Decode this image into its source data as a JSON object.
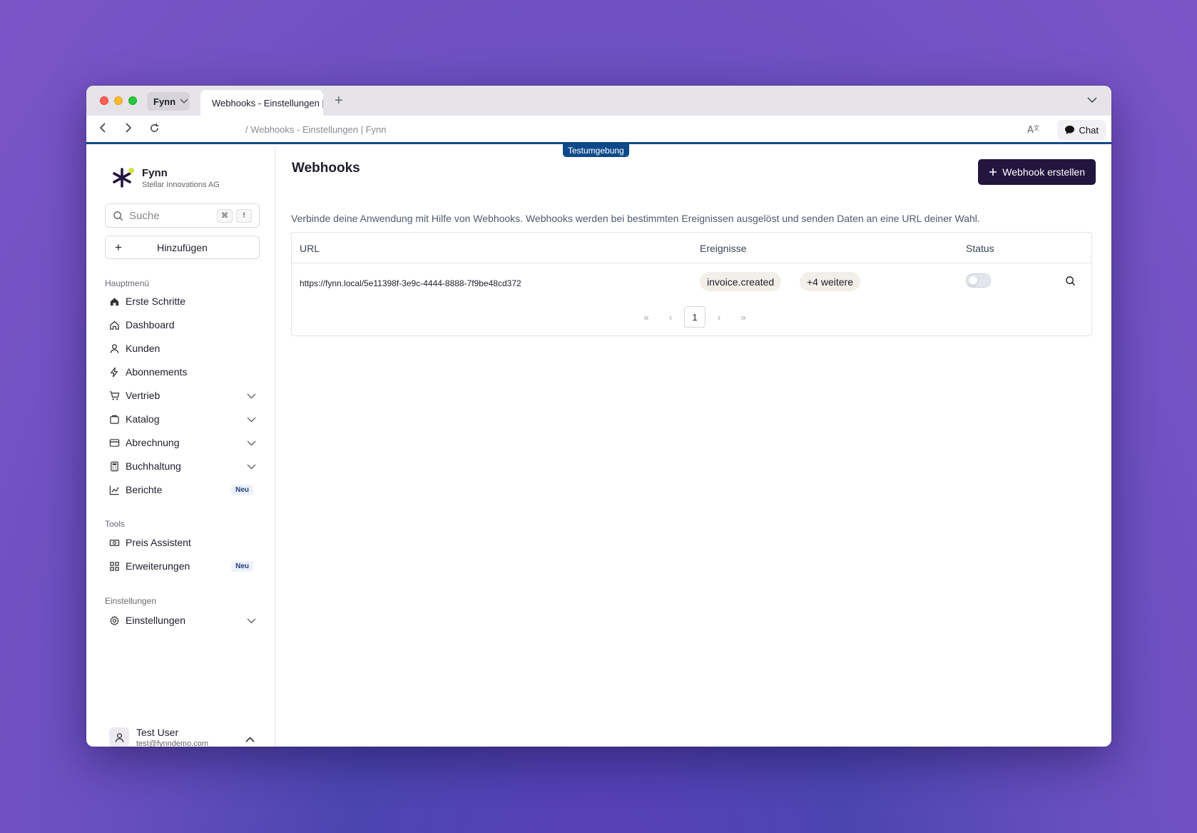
{
  "browser": {
    "profile_label": "Fynn",
    "tab_title": "Webhooks - Einstellungen | Fynn",
    "new_tab": "+",
    "address": "/ Webhooks - Einstellungen | Fynn",
    "chat_label": "Chat"
  },
  "environment_badge": "Testumgebung",
  "sidebar": {
    "brand_name": "Fynn",
    "brand_org": "Stellar Innovations AG",
    "search_placeholder": "Suche",
    "search_kbd_1": "⌘",
    "search_kbd_2": "f",
    "add_label": "Hinzufügen",
    "sections": {
      "main": "Hauptmenü",
      "tools": "Tools",
      "settings": "Einstellungen"
    },
    "main_items": [
      {
        "label": "Erste Schritte",
        "icon": "home-icon"
      },
      {
        "label": "Dashboard",
        "icon": "dashboard-icon"
      },
      {
        "label": "Kunden",
        "icon": "user-icon"
      },
      {
        "label": "Abonnements",
        "icon": "bolt-icon"
      },
      {
        "label": "Vertrieb",
        "icon": "cart-icon"
      },
      {
        "label": "Katalog",
        "icon": "box-icon"
      },
      {
        "label": "Abrechnung",
        "icon": "card-icon"
      },
      {
        "label": "Buchhaltung",
        "icon": "calculator-icon"
      },
      {
        "label": "Berichte",
        "icon": "chart-icon",
        "badge": "Neu"
      }
    ],
    "tool_items": [
      {
        "label": "Preis Assistent",
        "icon": "money-icon"
      },
      {
        "label": "Erweiterungen",
        "icon": "apps-icon",
        "badge": "Neu"
      }
    ],
    "settings_items": [
      {
        "label": "Einstellungen",
        "icon": "gear-icon"
      }
    ],
    "user": {
      "name": "Test User",
      "email": "test@fynndemo.com"
    }
  },
  "main": {
    "title": "Webhooks",
    "create_button": "Webhook erstellen",
    "description": "Verbinde deine Anwendung mit Hilfe von Webhooks. Webhooks werden bei bestimmten Ereignissen ausgelöst und senden Daten an eine URL deiner Wahl.",
    "table": {
      "columns": [
        "URL",
        "Ereignisse",
        "Status"
      ],
      "rows": [
        {
          "url": "https://fynn.local/5e11398f-3e9c-4444-8888-7f9be48cd372",
          "event": "invoice.created",
          "more_events": "+4 weitere",
          "active": false
        }
      ]
    },
    "pagination": {
      "first": "«",
      "prev": "‹",
      "current": "1",
      "next": "›",
      "last": "»"
    }
  },
  "colors": {
    "accent_dark": "#24153f",
    "env_blue": "#0e4a8a"
  }
}
